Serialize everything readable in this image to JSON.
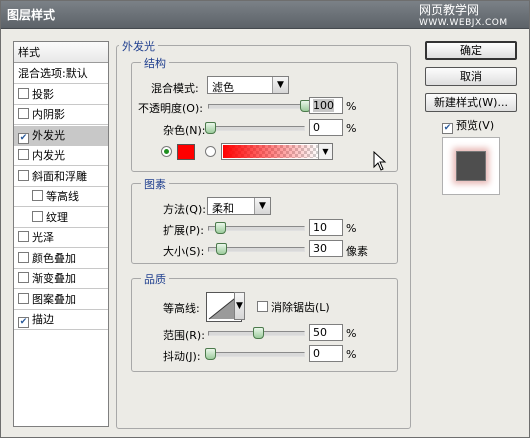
{
  "window": {
    "title": "图层样式",
    "watermark_line1": "网页教学网",
    "watermark_line2": "WWW.WEBJX.COM"
  },
  "style_list": {
    "header": "样式",
    "items": [
      {
        "label": "混合选项:默认",
        "checkbox": false,
        "checked": false,
        "selected": false,
        "sub": false
      },
      {
        "label": "投影",
        "checkbox": true,
        "checked": false,
        "selected": false,
        "sub": false
      },
      {
        "label": "内阴影",
        "checkbox": true,
        "checked": false,
        "selected": false,
        "sub": false
      },
      {
        "label": "外发光",
        "checkbox": true,
        "checked": true,
        "selected": true,
        "sub": false
      },
      {
        "label": "内发光",
        "checkbox": true,
        "checked": false,
        "selected": false,
        "sub": false
      },
      {
        "label": "斜面和浮雕",
        "checkbox": true,
        "checked": false,
        "selected": false,
        "sub": false
      },
      {
        "label": "等高线",
        "checkbox": true,
        "checked": false,
        "selected": false,
        "sub": true
      },
      {
        "label": "纹理",
        "checkbox": true,
        "checked": false,
        "selected": false,
        "sub": true
      },
      {
        "label": "光泽",
        "checkbox": true,
        "checked": false,
        "selected": false,
        "sub": false
      },
      {
        "label": "颜色叠加",
        "checkbox": true,
        "checked": false,
        "selected": false,
        "sub": false
      },
      {
        "label": "渐变叠加",
        "checkbox": true,
        "checked": false,
        "selected": false,
        "sub": false
      },
      {
        "label": "图案叠加",
        "checkbox": true,
        "checked": false,
        "selected": false,
        "sub": false
      },
      {
        "label": "描边",
        "checkbox": true,
        "checked": true,
        "selected": false,
        "sub": false
      }
    ]
  },
  "outer_glow": {
    "title": "外发光",
    "structure": {
      "title": "结构",
      "blend_mode_label": "混合模式:",
      "blend_mode_value": "滤色",
      "opacity_label": "不透明度(O):",
      "opacity_value": "100",
      "opacity_fraction": 1.0,
      "noise_label": "杂色(N):",
      "noise_value": "0",
      "noise_fraction": 0.0,
      "percent": "%",
      "color": "#ff0000"
    },
    "elements": {
      "title": "图素",
      "technique_label": "方法(Q):",
      "technique_value": "柔和",
      "spread_label": "扩展(P):",
      "spread_value": "10",
      "spread_fraction": 0.1,
      "size_label": "大小(S):",
      "size_value": "30",
      "size_fraction": 0.12,
      "percent": "%",
      "px_unit": "像素"
    },
    "quality": {
      "title": "品质",
      "contour_label": "等高线:",
      "antialias_label": "消除锯齿(L)",
      "range_label": "范围(R):",
      "range_value": "50",
      "range_fraction": 0.5,
      "jitter_label": "抖动(J):",
      "jitter_value": "0",
      "jitter_fraction": 0.0,
      "percent": "%"
    }
  },
  "buttons": {
    "ok": "确定",
    "cancel": "取消",
    "new_style": "新建样式(W)...",
    "preview_label": "预览(V)"
  },
  "icons": {
    "dropdown": "chevron-down-icon",
    "checkmark": "check-icon",
    "cursor": "arrow-cursor-icon"
  }
}
